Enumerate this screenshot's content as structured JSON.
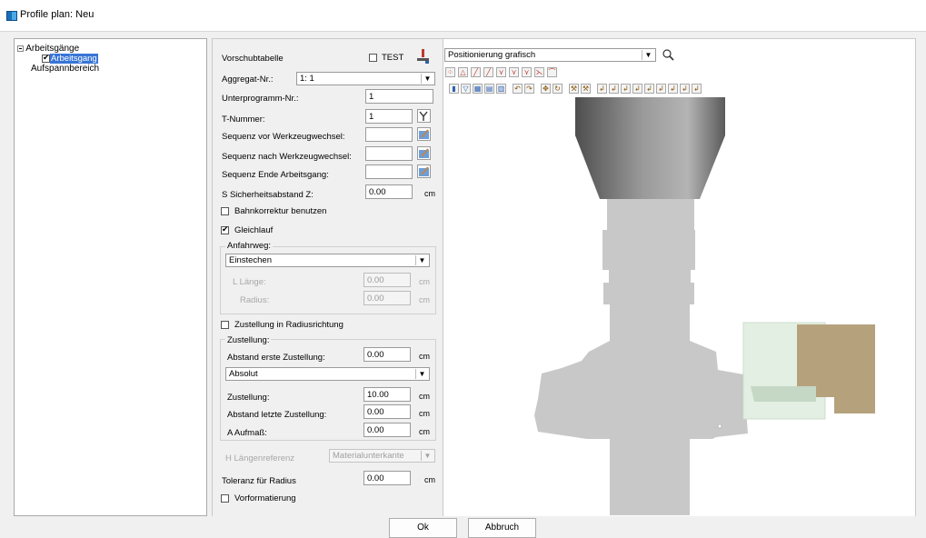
{
  "window": {
    "title": "Profile plan: Neu"
  },
  "tree": {
    "root": "Arbeitsgänge",
    "child": "Arbeitsgang",
    "child_checked": true,
    "sibling": "Aufspannbereich"
  },
  "form": {
    "vorschubtabelle": "Vorschubtabelle",
    "test_label": "TEST",
    "aggregat_label": "Aggregat-Nr.:",
    "aggregat_value": "1: 1",
    "unterprogramm_label": "Unterprogramm-Nr.:",
    "unterprogramm_value": "1",
    "tnummer_label": "T-Nummer:",
    "tnummer_value": "1",
    "seq_vor_label": "Sequenz vor Werkzeugwechsel:",
    "seq_nach_label": "Sequenz nach Werkzeugwechsel:",
    "seq_ende_label": "Sequenz Ende Arbeitsgang:",
    "sicherheit_label": "S Sicherheitsabstand Z:",
    "sicherheit_value": "0.00",
    "unit_cm": "cm",
    "bahnkorrektur_label": "Bahnkorrektur benutzen",
    "gleichlauf_label": "Gleichlauf",
    "anfahrweg_group": "Anfahrweg:",
    "anfahrweg_value": "Einstechen",
    "laenge_label": "L Länge:",
    "laenge_value": "0.00",
    "radius_label": "Radius:",
    "radius_value": "0.00",
    "zustellung_radius_label": "Zustellung in Radiusrichtung",
    "zustellung_group": "Zustellung:",
    "abstand_erste_label": "Abstand erste Zustellung:",
    "abstand_erste_value": "0.00",
    "modus_value": "Absolut",
    "zustellung_label": "Zustellung:",
    "zustellung_value": "10.00",
    "abstand_letzte_label": "Abstand letzte Zustellung:",
    "abstand_letzte_value": "0.00",
    "aufmass_label": "A Aufmaß:",
    "aufmass_value": "0.00",
    "laengenreferenz_label": "H Längenreferenz",
    "laengenreferenz_value": "Materialunterkante",
    "toleranz_label": "Toleranz für Radius",
    "toleranz_value": "0.00",
    "vorformatierung_label": "Vorformatierung"
  },
  "graphic": {
    "view_mode": "Positionierung grafisch",
    "toolbar1_icons": [
      "points-icon",
      "triangle-icon",
      "line-icon",
      "line2-icon",
      "angle-icon",
      "angle2-icon",
      "angle3-icon",
      "branch-icon",
      "arc-icon"
    ],
    "toolbar2_icons": [
      "pause-icon",
      "filter-icon",
      "layers-icon",
      "view-icon",
      "grid-icon",
      "undo-icon",
      "redo-icon",
      "move-icon",
      "rotate-icon",
      "tool-icon",
      "tool2-icon",
      "s1-icon",
      "s2-icon",
      "s3-icon",
      "s4-icon",
      "s5-icon",
      "s6-icon",
      "s7-icon",
      "s8-icon",
      "s9-icon"
    ],
    "colors": {
      "tool": "#c8c8c8",
      "head_dark": "#555555",
      "material": "#b5a27d",
      "material_light": "#dcecdc"
    }
  },
  "buttons": {
    "ok": "Ok",
    "cancel": "Abbruch"
  }
}
